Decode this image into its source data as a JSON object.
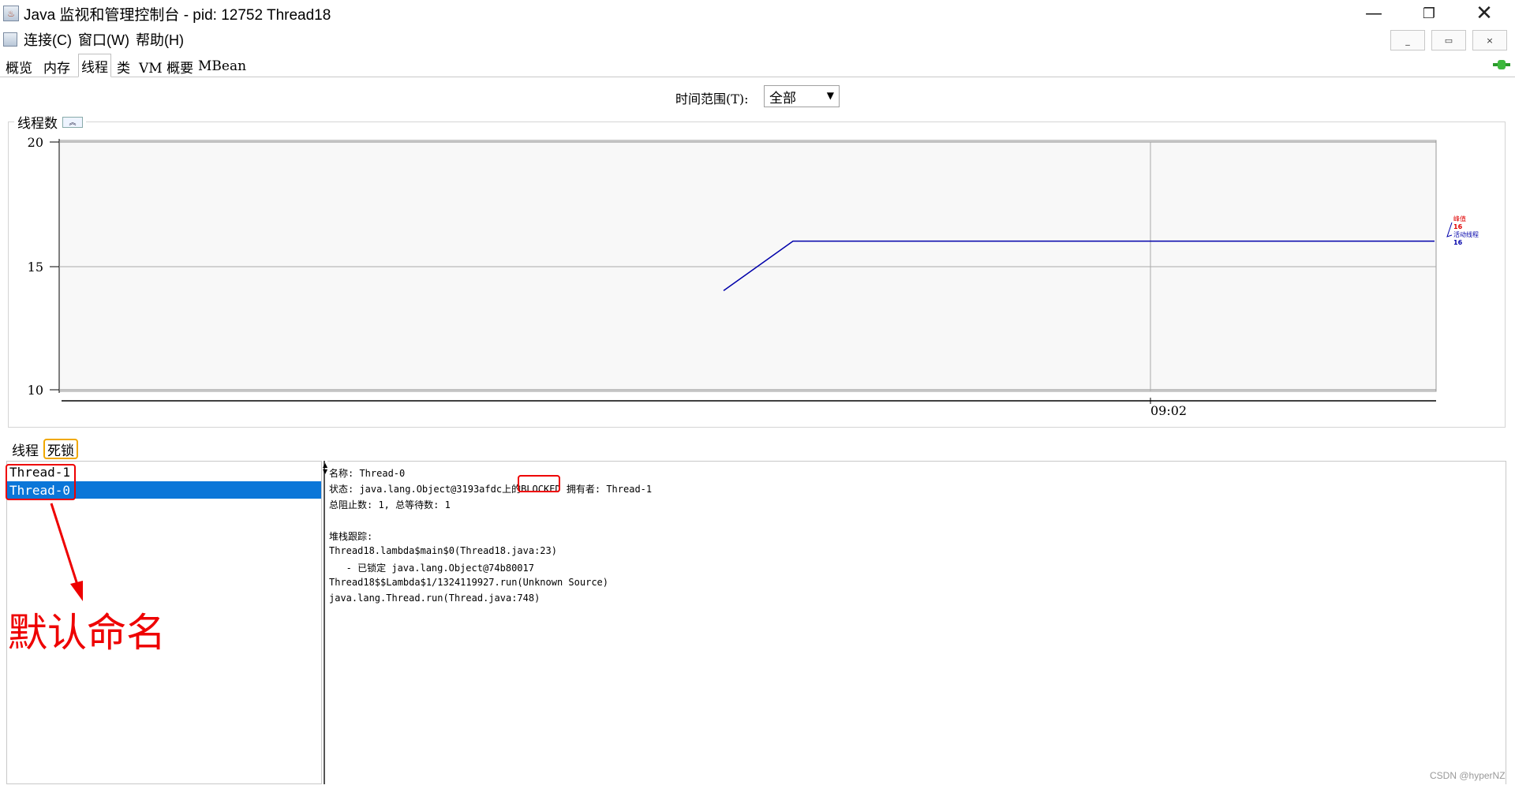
{
  "window": {
    "title": "Java 监视和管理控制台 - pid: 12752 Thread18",
    "minimize": "—",
    "maximize": "❐",
    "close": "✕"
  },
  "menu": {
    "items": [
      "连接(C)",
      "窗口(W)",
      "帮助(H)"
    ],
    "mdi_min": "_",
    "mdi_restore": "▭",
    "mdi_close": "×"
  },
  "tabs": [
    "概览",
    "内存",
    "线程",
    "类",
    "VM 概要",
    "MBean"
  ],
  "active_tab": "线程",
  "time_range": {
    "label": "时间范围(T):",
    "value": "全部"
  },
  "chart_panel": {
    "title": "线程数",
    "collapse": "︽"
  },
  "chart_data": {
    "type": "line",
    "ylim": [
      10,
      20
    ],
    "yticks": [
      "20",
      "15",
      "10"
    ],
    "xtick": "09:02",
    "series": [
      {
        "name": "峰值",
        "value_label": "16",
        "color": "#e00000"
      },
      {
        "name": "活动线程",
        "value_label": "16",
        "color": "#0000aa"
      }
    ],
    "points": [
      [
        0,
        14
      ],
      [
        1,
        16
      ],
      [
        2,
        16
      ]
    ]
  },
  "bottom_tabs": [
    "线程",
    "死锁"
  ],
  "threads": [
    "Thread-1",
    "Thread-0"
  ],
  "selected_thread": 1,
  "detail": {
    "name_line": "名称: Thread-0",
    "state_prefix": "状态: java.lang.Object@3193afdc上的",
    "state_value": "BLOCKED",
    "state_suffix": " 拥有者: Thread-1",
    "counts": "总阻止数: 1, 总等待数: 1",
    "stack_title": "堆栈跟踪:",
    "stack": [
      "Thread18.lambda$main$0(Thread18.java:23)",
      "   - 已锁定 java.lang.Object@74b80017",
      "Thread18$$Lambda$1/1324119927.run(Unknown Source)",
      "java.lang.Thread.run(Thread.java:748)"
    ]
  },
  "annotation": "默认命名",
  "watermark": "CSDN @hyperNZ",
  "colors": {
    "selection": "#0b76d8",
    "annotation": "#e00000",
    "line": "#0000aa"
  }
}
